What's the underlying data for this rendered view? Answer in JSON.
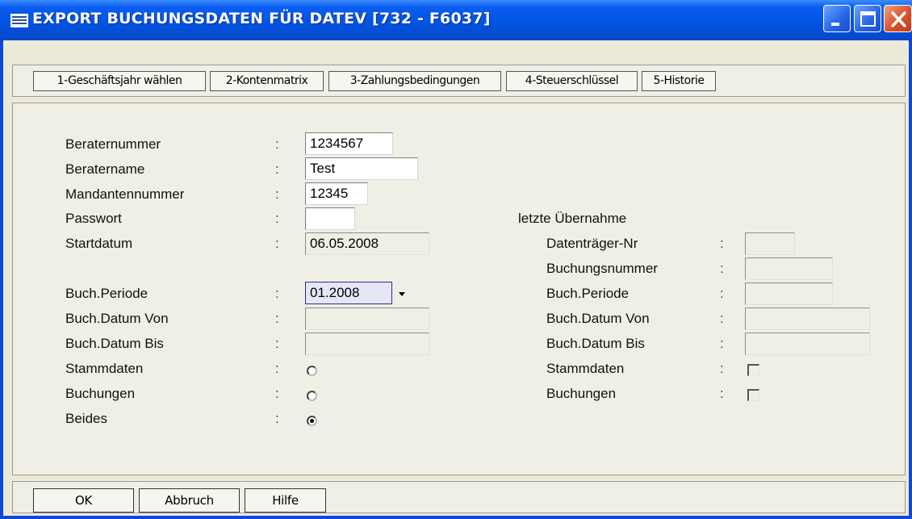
{
  "window": {
    "title": "EXPORT BUCHUNGSDATEN FÜR DATEV  [732 - F6037]"
  },
  "tabs": [
    "1-Geschäftsjahr wählen",
    "2-Kontenmatrix",
    "3-Zahlungsbedingungen",
    "4-Steuerschlüssel",
    "5-Historie"
  ],
  "form": {
    "separator": ":",
    "beraternummer": {
      "label": "Beraternummer",
      "value": "1234567"
    },
    "beratername": {
      "label": "Beratername",
      "value": "Test"
    },
    "mandantennummer": {
      "label": "Mandantennummer",
      "value": "12345"
    },
    "passwort": {
      "label": "Passwort",
      "value": ""
    },
    "startdatum": {
      "label": "Startdatum",
      "value": "06.05.2008"
    },
    "buch_periode": {
      "label": "Buch.Periode",
      "value": "01.2008"
    },
    "buch_datum_von": {
      "label": "Buch.Datum Von",
      "value": ""
    },
    "buch_datum_bis": {
      "label": "Buch.Datum Bis",
      "value": ""
    },
    "export_type": {
      "options": [
        "Stammdaten",
        "Buchungen",
        "Beides"
      ],
      "selected": "Beides"
    }
  },
  "last_transfer": {
    "heading": "letzte Übernahme",
    "datentraeger_nr": {
      "label": "Datenträger-Nr",
      "value": ""
    },
    "buchungsnummer": {
      "label": "Buchungsnummer",
      "value": ""
    },
    "buch_periode": {
      "label": "Buch.Periode",
      "value": ""
    },
    "buch_datum_von": {
      "label": "Buch.Datum Von",
      "value": ""
    },
    "buch_datum_bis": {
      "label": "Buch.Datum Bis",
      "value": ""
    },
    "stammdaten": {
      "label": "Stammdaten",
      "checked": false
    },
    "buchungen": {
      "label": "Buchungen",
      "checked": false
    }
  },
  "buttons": {
    "ok": "OK",
    "cancel": "Abbruch",
    "help": "Hilfe"
  },
  "colors": {
    "titlebar": "#0054e3",
    "close_button": "#d9532a",
    "background": "#ece9d8"
  }
}
